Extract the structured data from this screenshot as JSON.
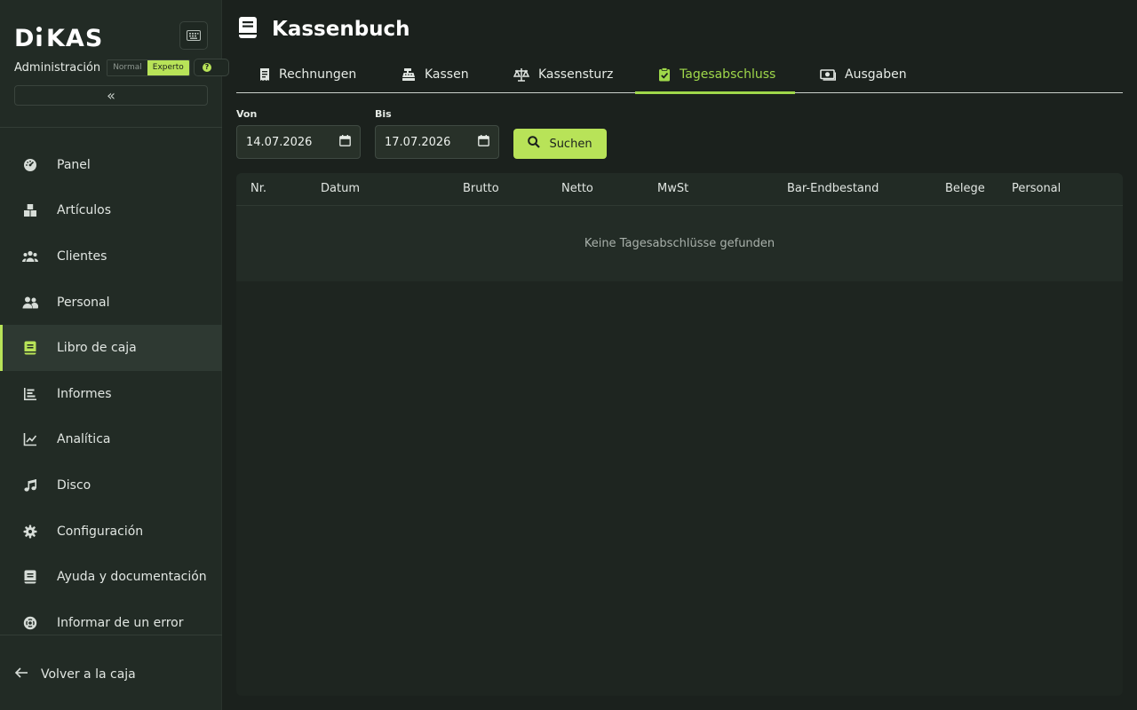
{
  "app": {
    "logo": "DKAS",
    "role_label": "Administración",
    "modes": [
      "Normal",
      "Experto"
    ],
    "active_mode": "Experto"
  },
  "sidebar": {
    "collapse_glyph": "«",
    "items": [
      {
        "label": "Panel",
        "icon": "dashboard-icon"
      },
      {
        "label": "Artículos",
        "icon": "boxes-icon"
      },
      {
        "label": "Clientes",
        "icon": "users-icon"
      },
      {
        "label": "Personal",
        "icon": "staff-icon"
      },
      {
        "label": "Libro de caja",
        "icon": "book-icon",
        "active": true
      },
      {
        "label": "Informes",
        "icon": "bar-chart-icon"
      },
      {
        "label": "Analítica",
        "icon": "line-chart-icon"
      },
      {
        "label": "Disco",
        "icon": "music-icon"
      },
      {
        "label": "Configuración",
        "icon": "gear-icon"
      },
      {
        "label": "Ayuda y documentación",
        "icon": "document-icon"
      },
      {
        "label": "Informar de un error",
        "icon": "lifebuoy-icon"
      }
    ],
    "back_label": "Volver a la caja"
  },
  "header": {
    "title": "Kassenbuch"
  },
  "tabs": [
    {
      "label": "Rechnungen",
      "icon": "receipt-icon"
    },
    {
      "label": "Kassen",
      "icon": "cash-register-icon"
    },
    {
      "label": "Kassensturz",
      "icon": "scale-icon"
    },
    {
      "label": "Tagesabschluss",
      "icon": "clipboard-check-icon",
      "active": true
    },
    {
      "label": "Ausgaben",
      "icon": "money-icon"
    }
  ],
  "filters": {
    "from_label": "Von",
    "from_value": "14.07.2026",
    "to_label": "Bis",
    "to_value": "17.07.2026",
    "search_label": "Suchen"
  },
  "table": {
    "columns": [
      "Nr.",
      "Datum",
      "Brutto",
      "Netto",
      "MwSt",
      "Bar-Endbestand",
      "Belege",
      "Personal"
    ],
    "empty_message": "Keine Tagesabschlüsse gefunden"
  },
  "colors": {
    "accent": "#b8e358",
    "active_tab": "#9fd84a",
    "background": "#1b211d",
    "sidebar": "#222b25"
  }
}
